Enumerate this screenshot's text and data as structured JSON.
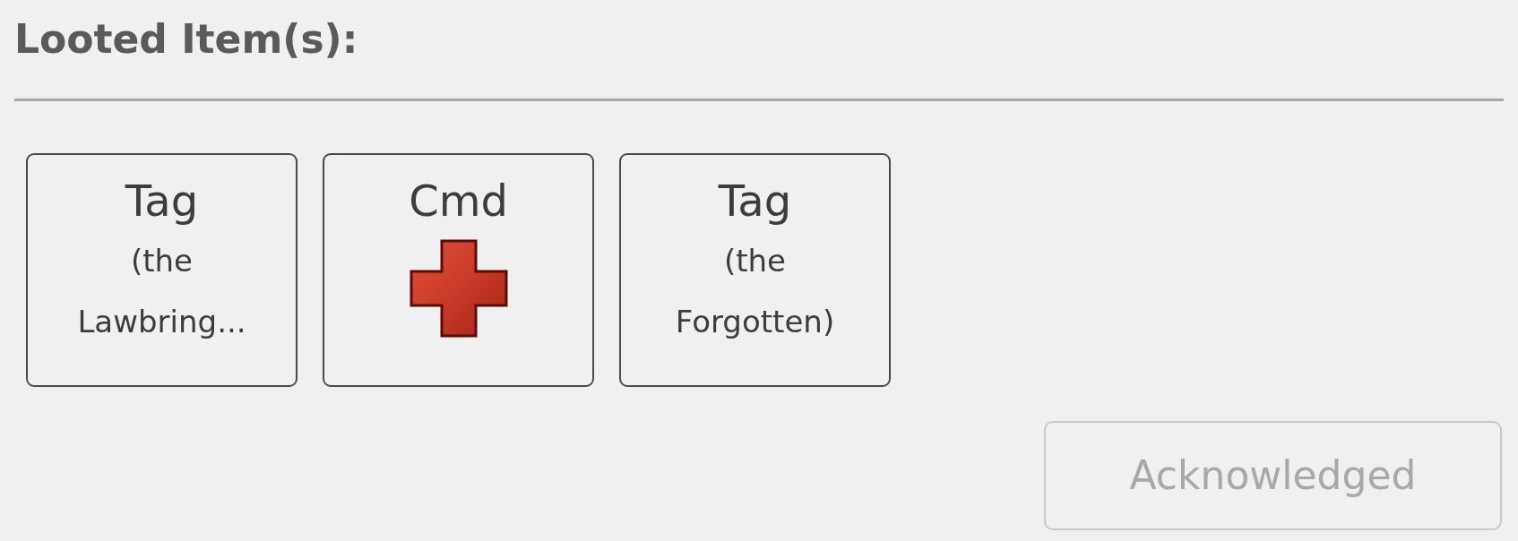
{
  "section": {
    "title": "Looted Item(s):"
  },
  "items": [
    {
      "kind": "text",
      "title": "Tag",
      "subtitle": "(the Lawbring..."
    },
    {
      "kind": "icon",
      "title": "Cmd"
    },
    {
      "kind": "text",
      "title": "Tag",
      "subtitle": "(the Forgotten)"
    }
  ],
  "button": {
    "label": "Acknowledged",
    "disabled": true
  }
}
